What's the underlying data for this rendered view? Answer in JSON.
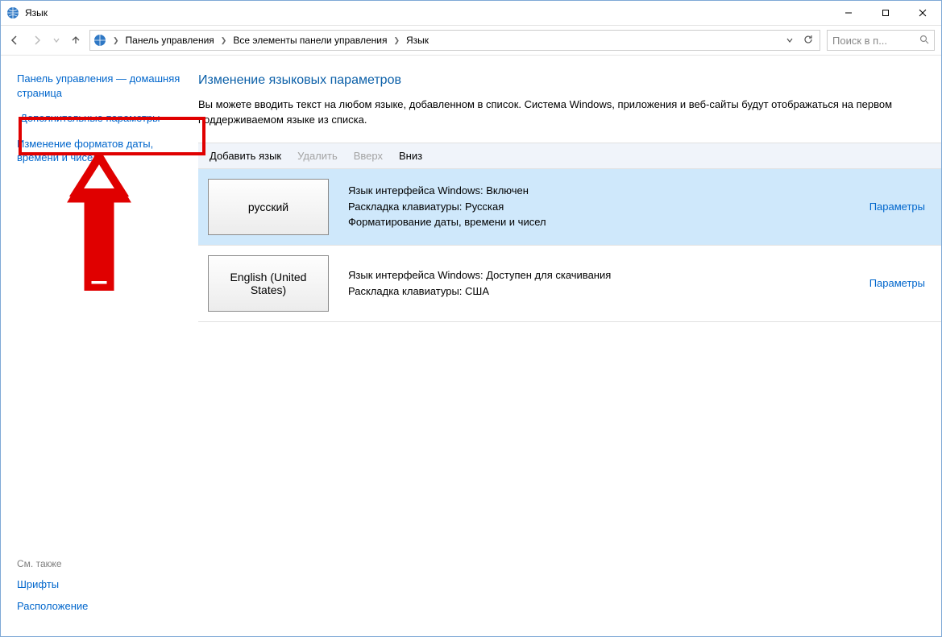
{
  "window": {
    "title": "Язык"
  },
  "breadcrumbs": {
    "item1": "Панель управления",
    "item2": "Все элементы панели управления",
    "item3": "Язык"
  },
  "search": {
    "placeholder": "Поиск в п..."
  },
  "sidebar": {
    "home": "Панель управления — домашняя страница",
    "advanced": "Дополнительные параметры",
    "datetime": "Изменение форматов даты, времени и чисел",
    "see_also_label": "См. также",
    "fonts": "Шрифты",
    "location": "Расположение"
  },
  "main": {
    "heading": "Изменение языковых параметров",
    "subtext": "Вы можете вводить текст на любом языке, добавленном в список. Система Windows, приложения и веб-сайты будут отображаться на первом поддерживаемом языке из списка."
  },
  "toolbar": {
    "add": "Добавить язык",
    "remove": "Удалить",
    "up": "Вверх",
    "down": "Вниз"
  },
  "langs": {
    "ru": {
      "tile": "русский",
      "line1": "Язык интерфейса Windows: Включен",
      "line2": "Раскладка клавиатуры: Русская",
      "line3": "Форматирование даты, времени и чисел",
      "opts": "Параметры"
    },
    "en": {
      "tile": "English (United States)",
      "line1": "Язык интерфейса Windows: Доступен для скачивания",
      "line2": "Раскладка клавиатуры: США",
      "opts": "Параметры"
    }
  }
}
